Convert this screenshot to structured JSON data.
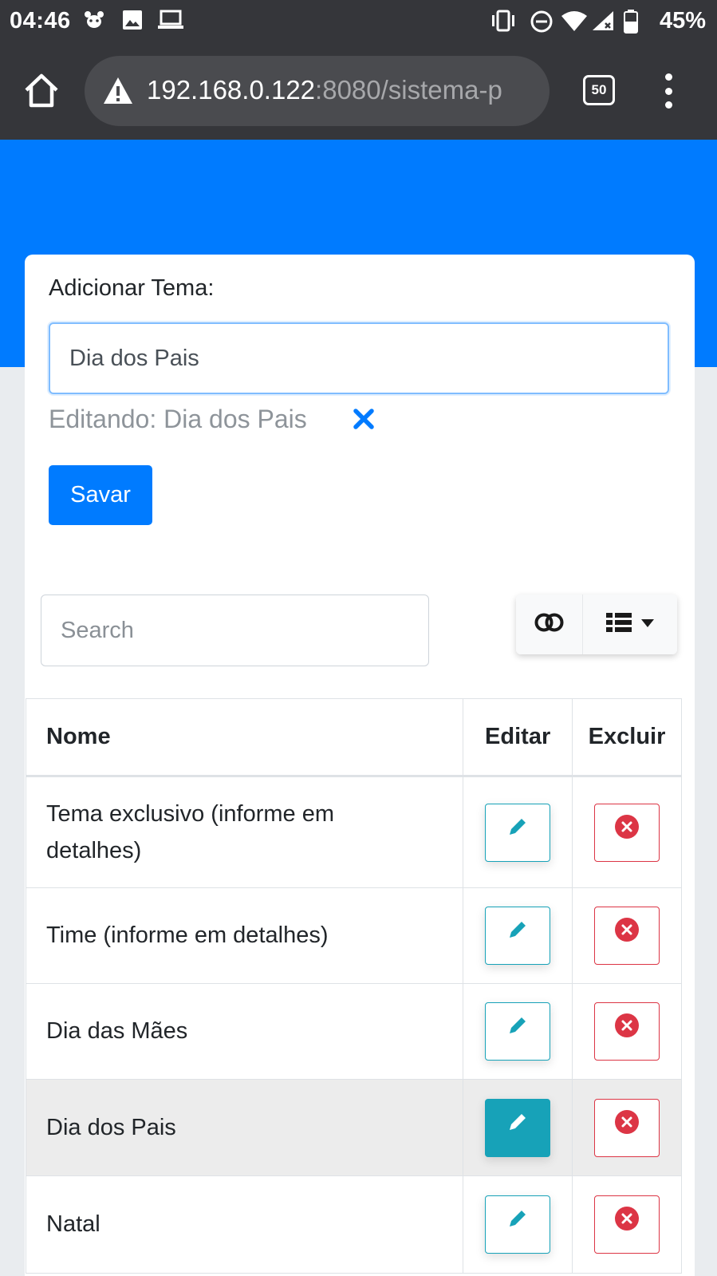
{
  "status_bar": {
    "time": "04:46",
    "battery": "45%"
  },
  "browser": {
    "url_host": "192.168.0.122",
    "url_rest": ":8080/sistema-p",
    "tab_count": "50"
  },
  "form": {
    "label": "Adicionar Tema:",
    "input_value": "Dia dos Pais",
    "editing_text": "Editando: Dia dos Pais",
    "save_label": "Savar"
  },
  "table_tools": {
    "search_placeholder": "Search"
  },
  "table": {
    "headers": [
      "Nome",
      "Editar",
      "Excluir"
    ],
    "rows": [
      {
        "name": "Tema exclusivo (informe em detalhes)"
      },
      {
        "name": "Time (informe em detalhes)"
      },
      {
        "name": "Dia das Mães"
      },
      {
        "name": "Dia dos Pais"
      },
      {
        "name": "Natal"
      }
    ],
    "highlighted_row": 3
  },
  "colors": {
    "primary": "#007bff",
    "info": "#17a2b8",
    "danger": "#dc3545",
    "chrome_bar": "#35363a"
  },
  "icons": [
    "home-icon",
    "warning-icon",
    "pencil-icon",
    "times-circle-icon",
    "close-icon",
    "toggle-icon",
    "list-icon",
    "caret-down-icon"
  ]
}
